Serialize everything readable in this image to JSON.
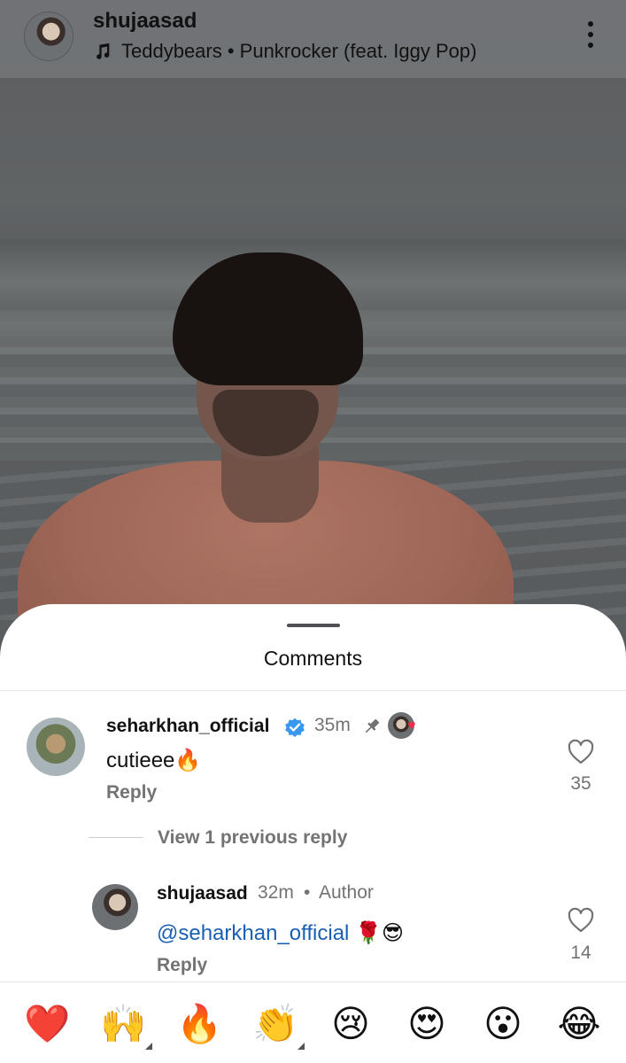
{
  "header": {
    "username": "shujaasad",
    "song": "Teddybears • Punkrocker (feat. Iggy Pop)",
    "music_icon": "music-note-icon",
    "more_icon": "more-vertical-icon"
  },
  "sheet": {
    "title": "Comments"
  },
  "comments": [
    {
      "username": "seharkhan_official",
      "verified": true,
      "time": "35m",
      "pinned": true,
      "liked_by_author": true,
      "text": "cutieee🔥",
      "reply_label": "Reply",
      "likes": "35"
    }
  ],
  "view_previous": "View 1 previous reply",
  "reply": {
    "username": "shujaasad",
    "time": "32m",
    "separator": "•",
    "author_label": "Author",
    "mention": "@seharkhan_official",
    "text_rest": " 🌹😎",
    "reply_label": "Reply",
    "likes": "14"
  },
  "emoji_bar": [
    "❤️",
    "🙌",
    "🔥",
    "👏",
    "😢",
    "😍",
    "😮",
    "😂"
  ],
  "colors": {
    "mention": "#1a5fb4",
    "heart": "#ed2d48",
    "verified": "#3897f0",
    "muted_text": "#737373"
  }
}
